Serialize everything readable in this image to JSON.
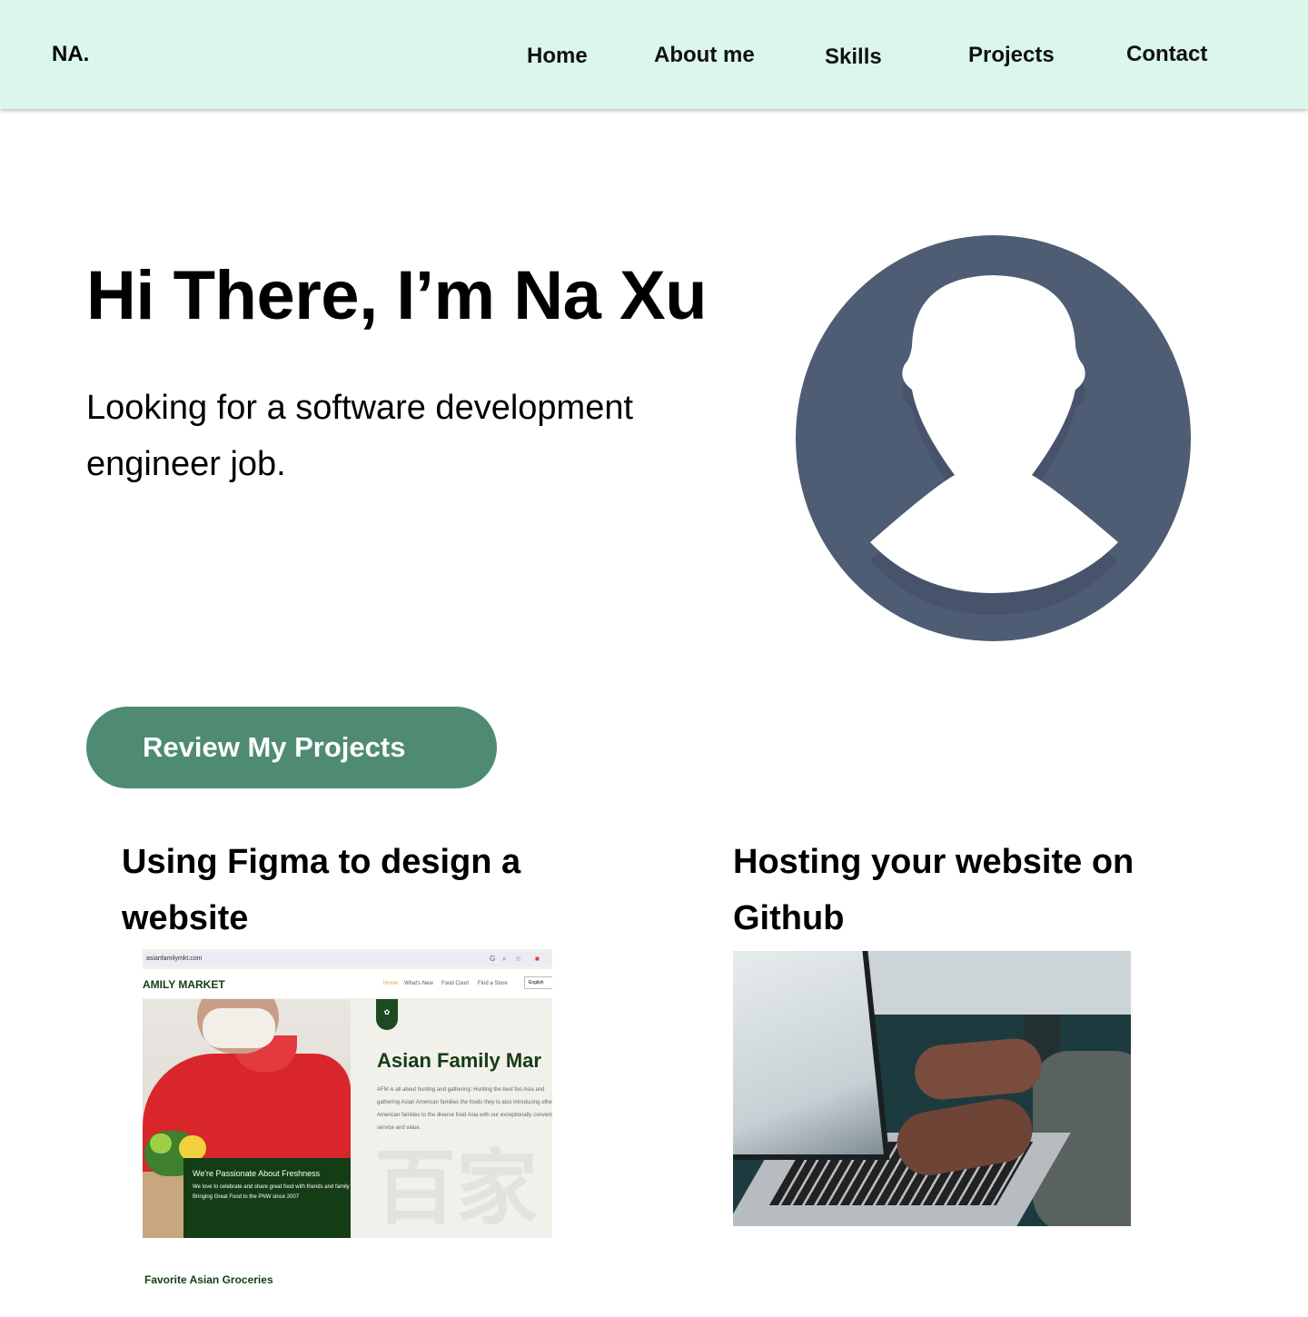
{
  "nav": {
    "brand": "NA.",
    "links": [
      "Home",
      "About me",
      "Skills",
      "Projects",
      "Contact"
    ]
  },
  "hero": {
    "title": "Hi There, I’m Na Xu",
    "subtitle": "Looking for a software development engineer job.",
    "cta_label": "Review My Projects"
  },
  "projects": [
    {
      "title": "Using Figma to design a website",
      "screenshot": {
        "url": "asianfamilymkt.com",
        "logo": "AMILY MARKET",
        "nav": [
          "Home",
          "What's New",
          "Food Court",
          "Find a Store"
        ],
        "lang": "English",
        "heading": "Asian Family Mar",
        "paragraph": "AFM is all about hunting and gathering: Hunting the best foo Asia and gathering Asian American families the foods they lo also introducing other American families to the diverse food Asia with our exceptionally convenient service and value.",
        "promo_title": "We're Passionate About Freshness",
        "promo_line1": "We love to celebrate and share great food with friends and family",
        "promo_line2": "Bringing Great Food to the PNW since 2007"
      },
      "caption": "Favorite Asian Groceries"
    },
    {
      "title": "Hosting your website on Github"
    }
  ],
  "colors": {
    "navbar_bg": "#dbf6ea",
    "cta_bg": "#4e8b72",
    "avatar": "#4e5c74"
  }
}
